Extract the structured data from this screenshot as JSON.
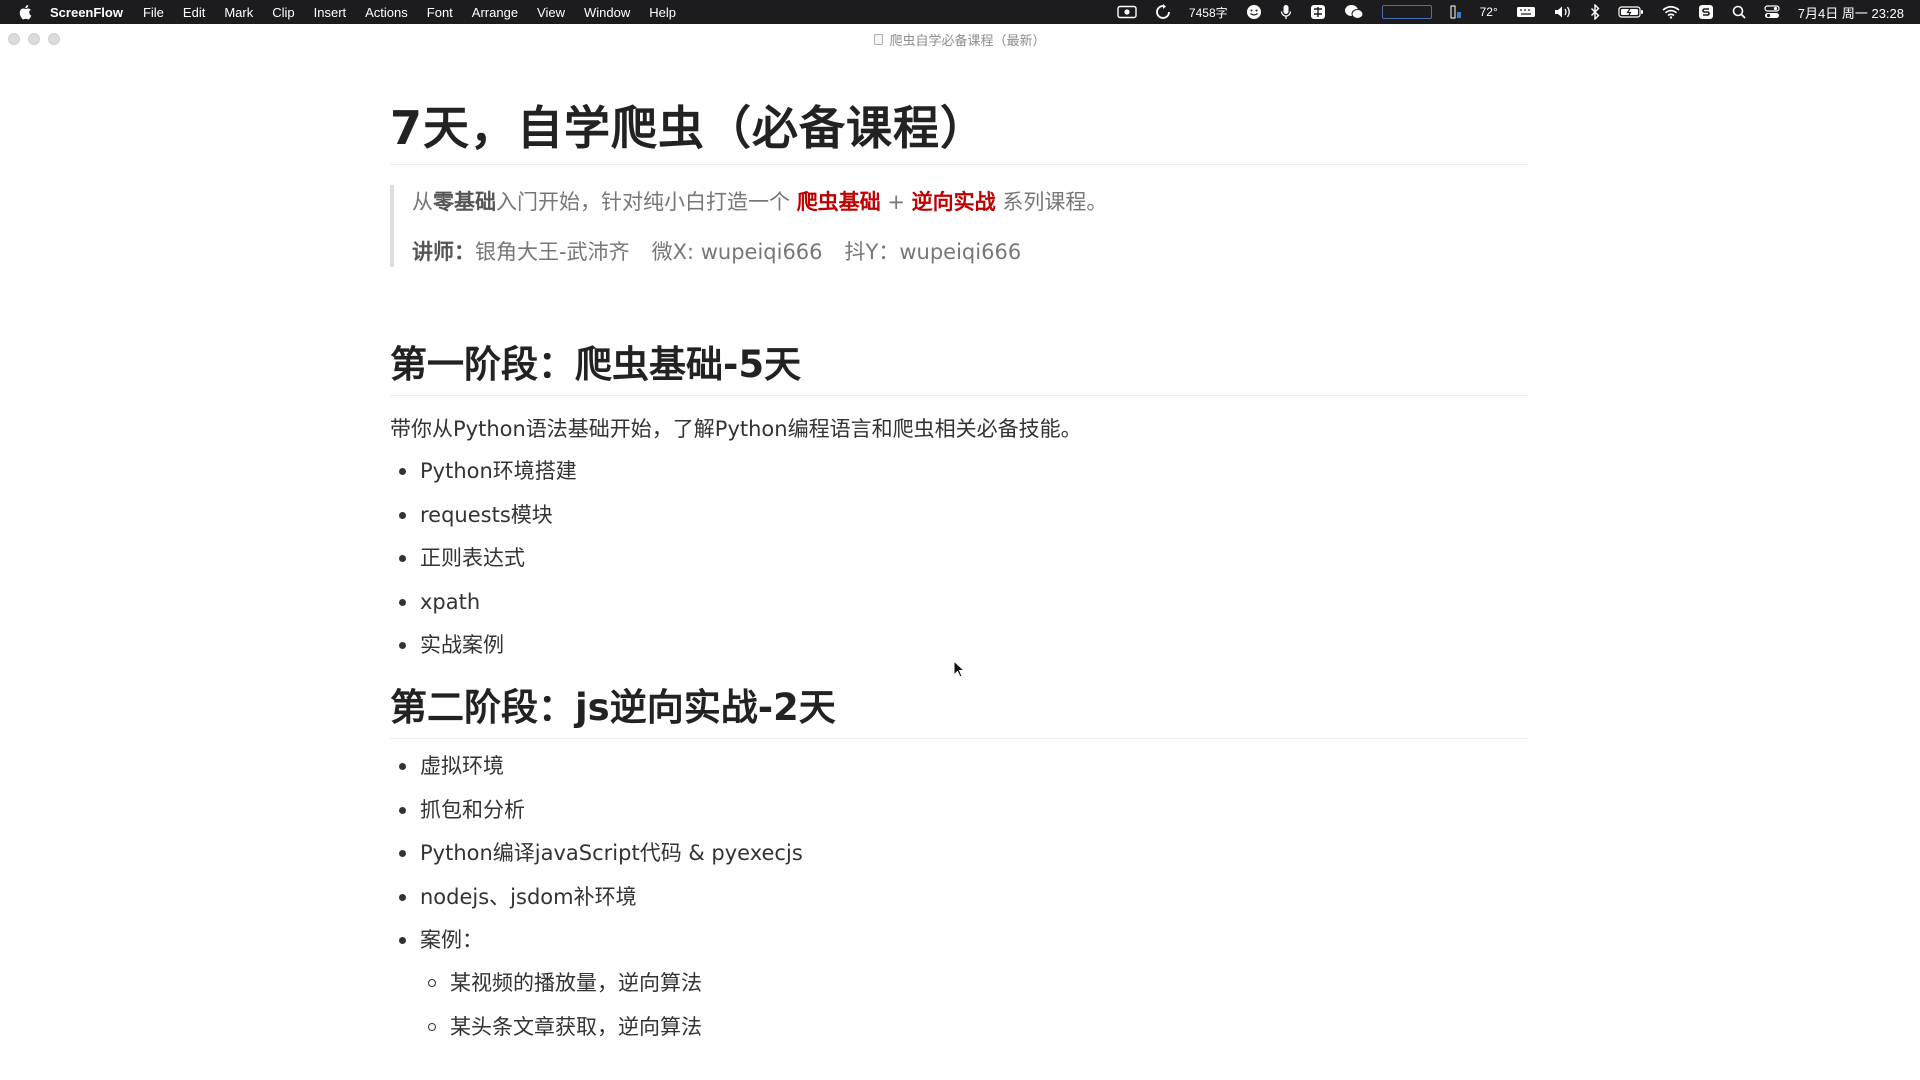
{
  "menubar": {
    "app_name": "ScreenFlow",
    "items": [
      "File",
      "Edit",
      "Mark",
      "Clip",
      "Insert",
      "Actions",
      "Font",
      "Arrange",
      "View",
      "Window",
      "Help"
    ],
    "word_count": "7458字",
    "temperature": "72°",
    "datetime": "7月4日 周一 23:28"
  },
  "window": {
    "title": "爬虫自学必备课程（最新）"
  },
  "document": {
    "title": "7天，自学爬虫（必备课程）",
    "quote": {
      "line1_prefix": "从",
      "line1_bold": "零基础",
      "line1_mid": "入门开始，针对纯小白打造一个 ",
      "highlight1": "爬虫基础",
      "plus": " + ",
      "highlight2": "逆向实战",
      "line1_suffix": " 系列课程。",
      "teacher_label": "讲师：",
      "teacher_name": "银角大王-武沛齐",
      "wechat": "微X: wupeiqi666",
      "douyin": "抖Y：wupeiqi666"
    },
    "section1": {
      "heading": "第一阶段：爬虫基础-5天",
      "intro": "带你从Python语法基础开始，了解Python编程语言和爬虫相关必备技能。",
      "items": [
        "Python环境搭建",
        "requests模块",
        "正则表达式",
        "xpath",
        "实战案例"
      ]
    },
    "section2": {
      "heading": "第二阶段：js逆向实战-2天",
      "items": [
        "虚拟环境",
        "抓包和分析",
        "Python编译javaScript代码 & pyexecjs",
        "nodejs、jsdom补环境"
      ],
      "case_label": "案例：",
      "cases": [
        "某视频的播放量，逆向算法",
        "某头条文章获取，逆向算法"
      ]
    }
  },
  "colors": {
    "highlight_red": "#c00000",
    "menubar_bg": "#1c1c1e"
  }
}
